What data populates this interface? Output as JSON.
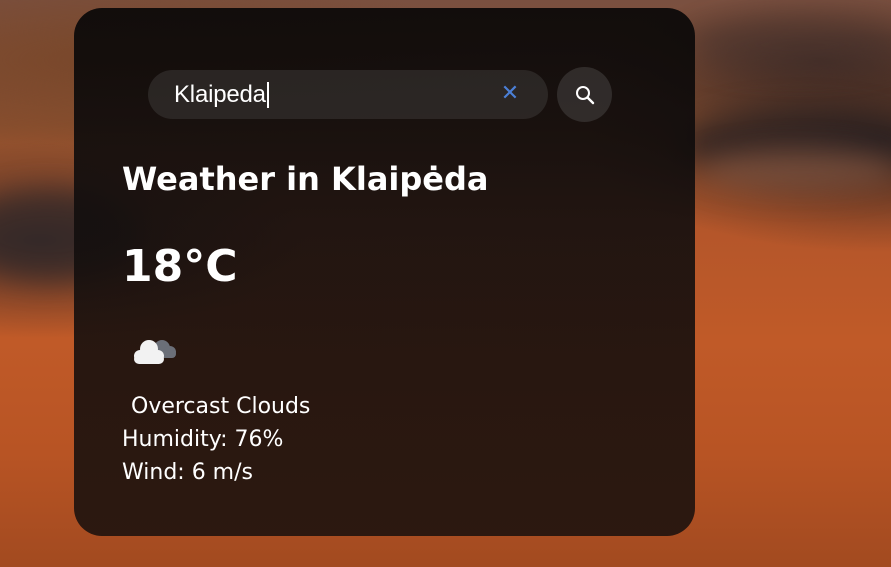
{
  "search": {
    "value": "Klaipeda",
    "clear_icon_name": "close-icon",
    "search_icon_name": "search-icon"
  },
  "weather": {
    "title": "Weather in Klaipėda",
    "temperature": "18°C",
    "icon_name": "overcast-clouds-icon",
    "description": "Overcast Clouds",
    "humidity": "Humidity: 76%",
    "wind": "Wind: 6 m/s"
  },
  "colors": {
    "accent_clear": "#4b7fd6",
    "text": "#ffffff"
  }
}
